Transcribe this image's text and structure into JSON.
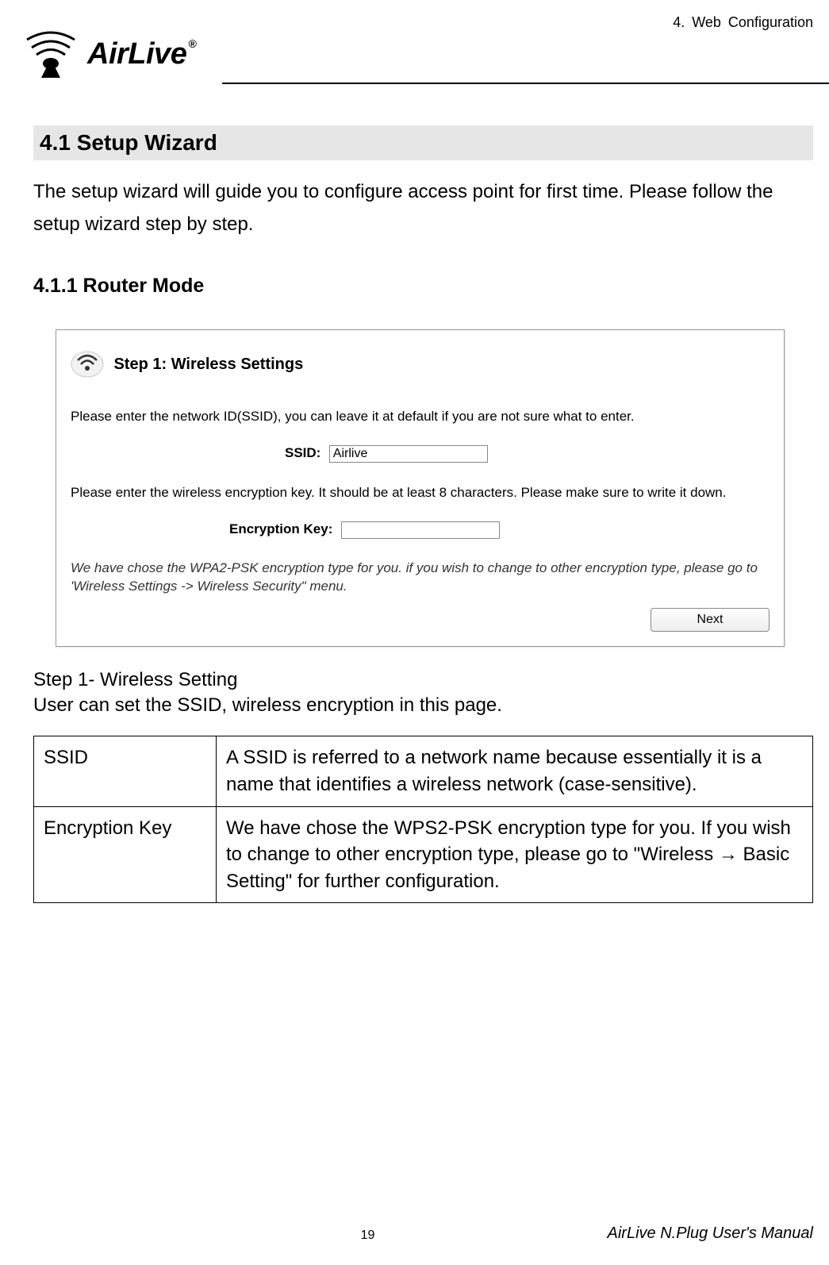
{
  "header": {
    "chapter": "4.  Web  Configuration",
    "logo_text": "AirLive",
    "logo_r": "®"
  },
  "section": {
    "title": "4.1 Setup  Wizard",
    "intro": "The setup wizard will guide you to configure access point for first time. Please follow the setup wizard step by step.",
    "subsection_title": "4.1.1 Router Mode"
  },
  "screenshot": {
    "step_title": "Step 1: Wireless Settings",
    "prompt1": "Please enter the network ID(SSID), you can leave it at default if you are not sure what to enter.",
    "ssid_label": "SSID:",
    "ssid_value": "Airlive",
    "prompt2": "Please enter the wireless encryption key. It should be at least 8 characters. Please make sure to write it down.",
    "enc_label": "Encryption Key:",
    "enc_value": "",
    "note": "We have chose the WPA2-PSK encryption type for you.  if you wish to change to other encryption type, please go to 'Wireless Settings -> Wireless Security\" menu.",
    "next_label": "Next"
  },
  "caption": {
    "line1": "Step 1- Wireless Setting",
    "line2": "User can set the SSID, wireless encryption in this page."
  },
  "table": {
    "rows": [
      {
        "col1": "SSID",
        "col2": "A SSID is referred to a network name because essentially it is a name that identifies a wireless network (case-sensitive)."
      },
      {
        "col1": "Encryption Key",
        "col2": "We have chose the WPS2-PSK encryption type for you. If you wish to change to other encryption type, please go to \"Wireless → Basic Setting\" for further configuration."
      }
    ]
  },
  "footer": {
    "page_number": "19",
    "manual_name": "AirLive N.Plug User's Manual"
  }
}
